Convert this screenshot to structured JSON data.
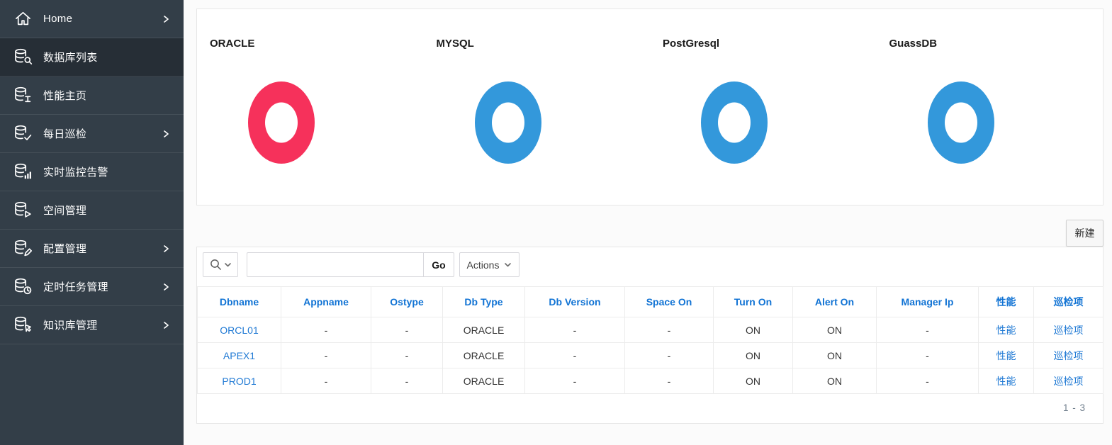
{
  "app": {
    "accent_blue": "#1173d4",
    "sidebar_bg": "#333e48",
    "sidebar_active_bg": "#262e36"
  },
  "sidebar": {
    "items": [
      {
        "label": "Home",
        "icon": "home-icon",
        "has_submenu": true,
        "active": false
      },
      {
        "label": "数据库列表",
        "icon": "database-search-icon",
        "has_submenu": false,
        "active": true
      },
      {
        "label": "性能主页",
        "icon": "database-performance-icon",
        "has_submenu": false,
        "active": false
      },
      {
        "label": "每日巡检",
        "icon": "database-check-icon",
        "has_submenu": true,
        "active": false
      },
      {
        "label": "实时监控告警",
        "icon": "database-chart-icon",
        "has_submenu": false,
        "active": false
      },
      {
        "label": "空间管理",
        "icon": "database-play-icon",
        "has_submenu": false,
        "active": false
      },
      {
        "label": "配置管理",
        "icon": "database-edit-icon",
        "has_submenu": true,
        "active": false
      },
      {
        "label": "定时任务管理",
        "icon": "database-clock-icon",
        "has_submenu": true,
        "active": false
      },
      {
        "label": "知识库管理",
        "icon": "database-pointer-icon",
        "has_submenu": true,
        "active": false
      }
    ]
  },
  "chart_data": [
    {
      "type": "pie",
      "donut": true,
      "title": "ORACLE",
      "labels": [
        "ORACLE"
      ],
      "values": [
        100
      ],
      "color": "#f6315b",
      "legend": "none"
    },
    {
      "type": "pie",
      "donut": true,
      "title": "MYSQL",
      "labels": [
        "MYSQL"
      ],
      "values": [
        100
      ],
      "color": "#3398db",
      "legend": "none"
    },
    {
      "type": "pie",
      "donut": true,
      "title": "PostGresql",
      "labels": [
        "PostGresql"
      ],
      "values": [
        100
      ],
      "color": "#3398db",
      "legend": "none"
    },
    {
      "type": "pie",
      "donut": true,
      "title": "GuassDB",
      "labels": [
        "GuassDB"
      ],
      "values": [
        100
      ],
      "color": "#3398db",
      "legend": "none"
    }
  ],
  "actions_region": {
    "new_button_label": "新建"
  },
  "toolbar": {
    "search_placeholder": "",
    "search_value": "",
    "go_label": "Go",
    "actions_label": "Actions"
  },
  "table": {
    "headers": [
      "Dbname",
      "Appname",
      "Ostype",
      "Db Type",
      "Db Version",
      "Space On",
      "Turn On",
      "Alert On",
      "Manager Ip",
      "性能",
      "巡检项"
    ],
    "rows": [
      [
        "ORCL01",
        "-",
        "-",
        "ORACLE",
        "-",
        "-",
        "ON",
        "ON",
        "-",
        "性能",
        "巡检项"
      ],
      [
        "APEX1",
        "-",
        "-",
        "ORACLE",
        "-",
        "-",
        "ON",
        "ON",
        "-",
        "性能",
        "巡检项"
      ],
      [
        "PROD1",
        "-",
        "-",
        "ORACLE",
        "-",
        "-",
        "ON",
        "ON",
        "-",
        "性能",
        "巡检项"
      ]
    ],
    "pagination": "1 - 3"
  }
}
